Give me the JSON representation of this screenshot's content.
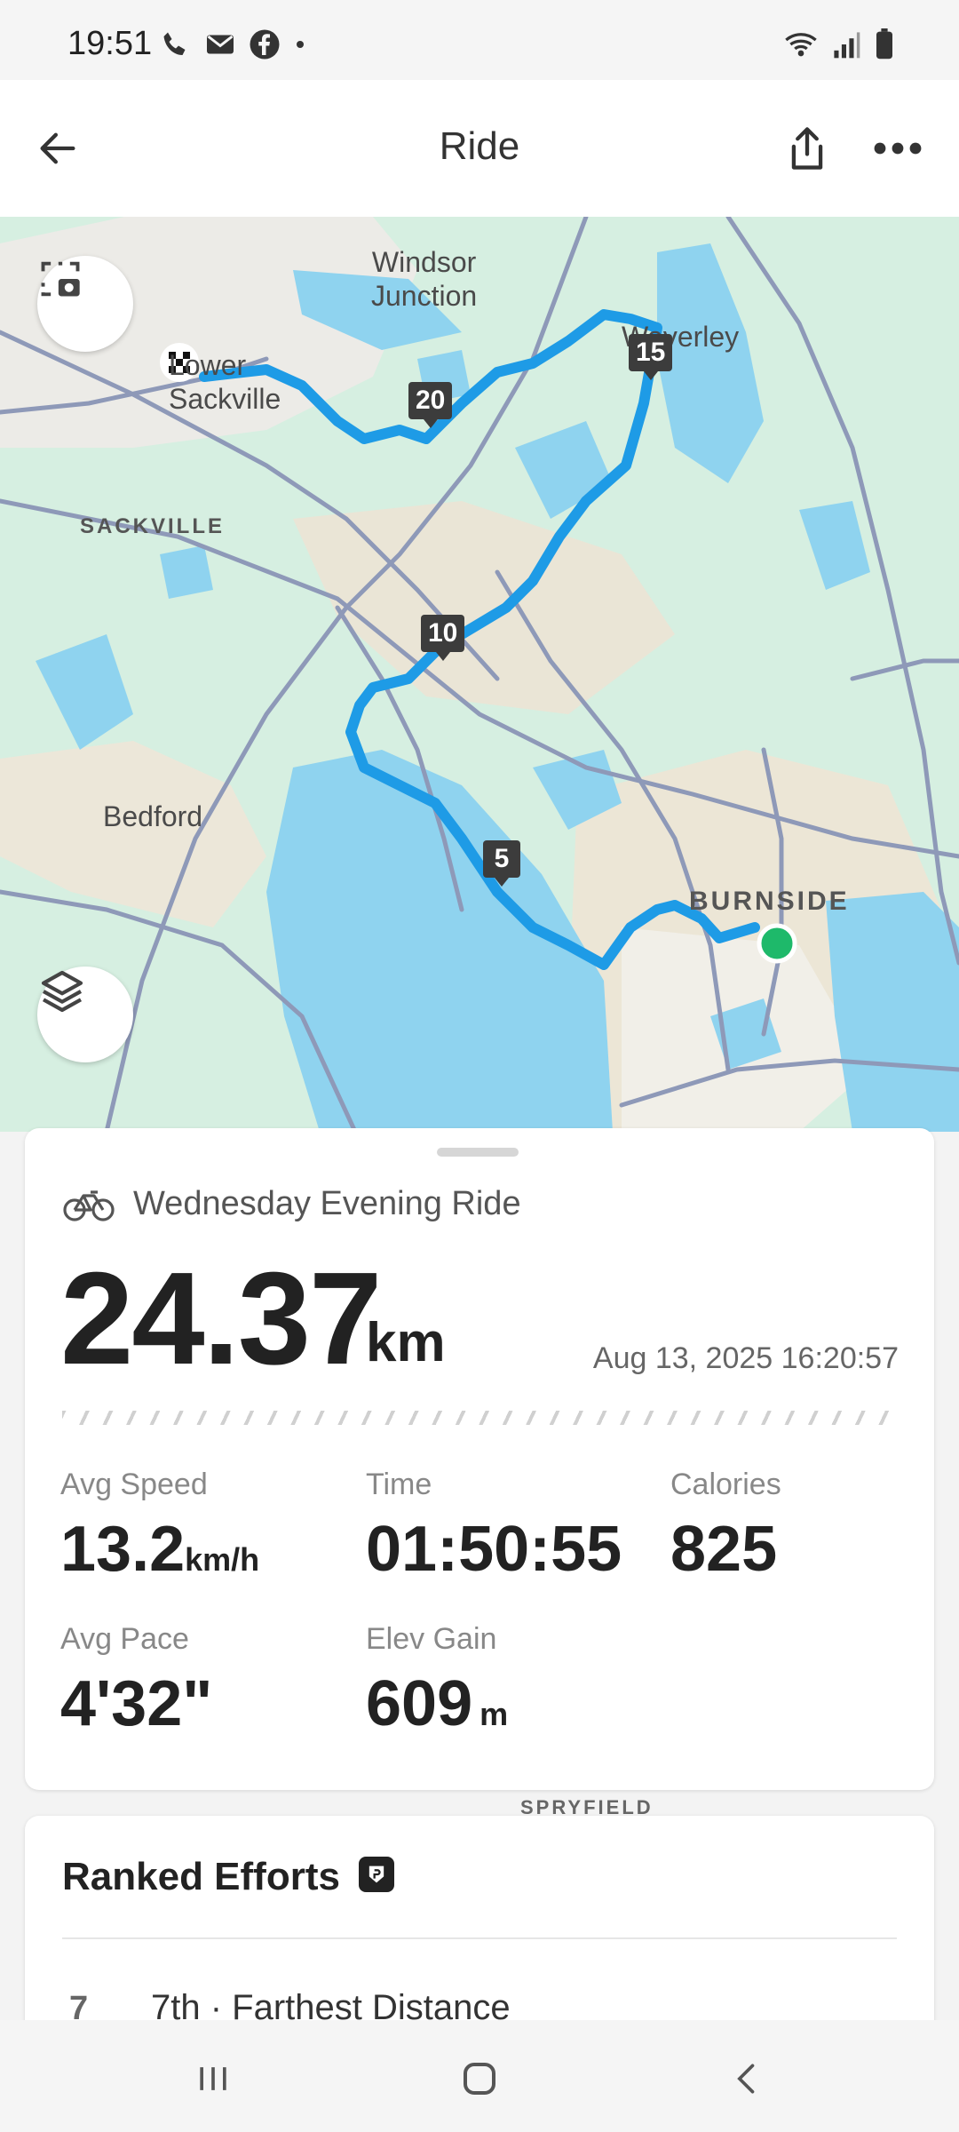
{
  "status_bar": {
    "time": "19:51"
  },
  "header": {
    "title": "Ride"
  },
  "map": {
    "labels": {
      "windsor_junction": "Windsor\nJunction",
      "waverley": "Waverley",
      "lower_sackville": "Lower\nSackville",
      "sackville": "SACKVILLE",
      "bedford": "Bedford",
      "burnside": "BURNSIDE",
      "spryfield": "SPRYFIELD"
    },
    "km_markers": [
      "5",
      "10",
      "15",
      "20"
    ],
    "colors": {
      "route": "#1e9be6",
      "water": "#8fd3ef",
      "land": "#d6efe1",
      "start": "#1eb96a"
    }
  },
  "activity": {
    "name": "Wednesday Evening Ride",
    "distance": "24.37",
    "distance_unit": "km",
    "datetime": "Aug 13, 2025 16:20:57",
    "stats": {
      "avg_speed": {
        "label": "Avg Speed",
        "value": "13.2",
        "unit": "km/h"
      },
      "time": {
        "label": "Time",
        "value": "01:50:55"
      },
      "calories": {
        "label": "Calories",
        "value": "825"
      },
      "avg_pace": {
        "label": "Avg Pace",
        "value": "4'32\""
      },
      "elev_gain": {
        "label": "Elev Gain",
        "value": "609",
        "unit": "m"
      }
    }
  },
  "ranked": {
    "title": "Ranked Efforts",
    "items": [
      {
        "rank": "7",
        "text": "7th · Farthest Distance"
      }
    ]
  }
}
